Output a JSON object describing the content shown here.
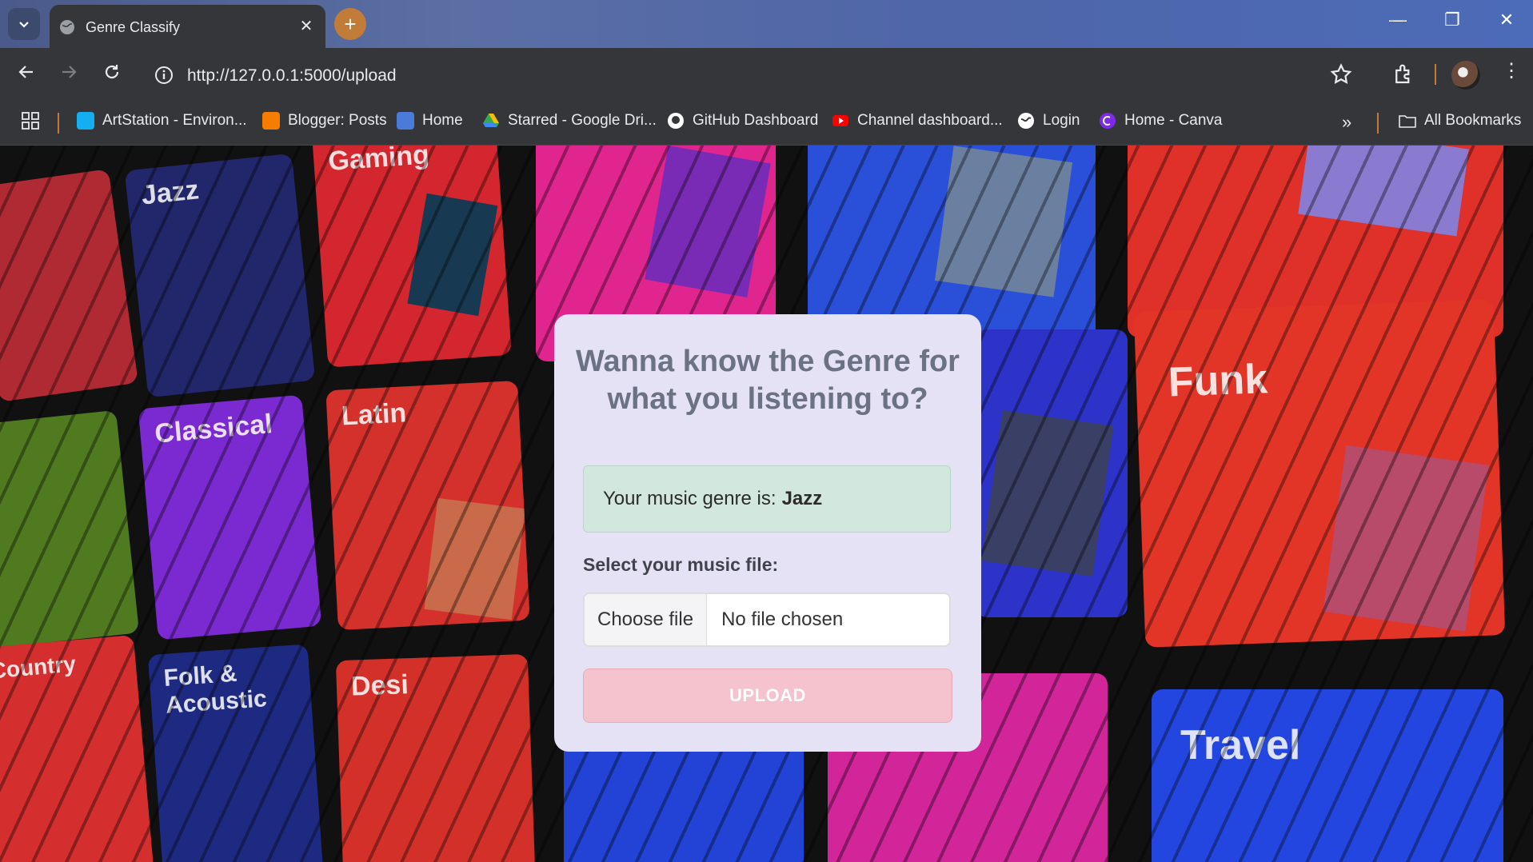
{
  "browser": {
    "tab_title": "Genre Classify",
    "tab_close": "✕",
    "new_tab": "+",
    "url": "http://127.0.0.1:5000/upload",
    "window_controls": {
      "minimize": "—",
      "restore": "❐",
      "close": "✕"
    },
    "bookmarks": [
      {
        "label": "ArtStation - Environ...",
        "icon": "artstation-icon",
        "color": "#13aff0"
      },
      {
        "label": "Blogger: Posts",
        "icon": "blogger-icon",
        "color": "#f57d00"
      },
      {
        "label": "Home",
        "icon": "home-icon",
        "color": "#4a7bd8"
      },
      {
        "label": "Starred - Google Dri...",
        "icon": "google-drive-icon",
        "color": "#34a853"
      },
      {
        "label": "GitHub Dashboard",
        "icon": "github-icon",
        "color": "#ffffff"
      },
      {
        "label": "Channel dashboard...",
        "icon": "youtube-icon",
        "color": "#ff0000"
      },
      {
        "label": "Login",
        "icon": "globe-icon",
        "color": "#ffffff"
      },
      {
        "label": "Home - Canva",
        "icon": "canva-icon",
        "color": "#7d2ae8"
      }
    ],
    "overflow": "»",
    "all_bookmarks": "All Bookmarks"
  },
  "background_tiles": [
    {
      "label": "Gaming"
    },
    {
      "label": "Jazz"
    },
    {
      "label": "Latin"
    },
    {
      "label": "Classical"
    },
    {
      "label": "Funk"
    },
    {
      "label": "Travel"
    },
    {
      "label": "Desi"
    },
    {
      "label": "Country"
    },
    {
      "label": "Folk & Acoustic"
    }
  ],
  "card": {
    "heading": "Wanna know the Genre for what you listening to?",
    "result_prefix": "Your music genre is:",
    "result_value": "Jazz",
    "select_label": "Select your music file:",
    "choose_file": "Choose file",
    "no_file": "No file chosen",
    "upload": "UPLOAD"
  },
  "colors": {
    "card_bg": "#e6e2f5",
    "result_bg": "#d2e7dd",
    "upload_bg": "#f4c3cd",
    "heading": "#6b7283"
  }
}
